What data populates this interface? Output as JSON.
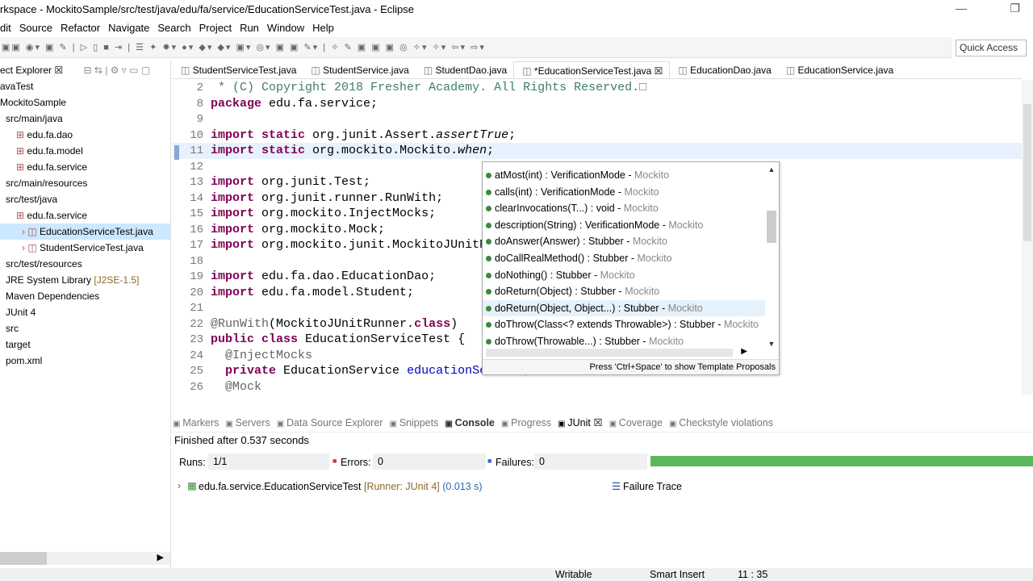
{
  "window": {
    "title": "rkspace - MockitoSample/src/test/java/edu/fa/service/EducationServiceTest.java - Eclipse"
  },
  "menu": [
    "dit",
    "Source",
    "Refactor",
    "Navigate",
    "Search",
    "Project",
    "Run",
    "Window",
    "Help"
  ],
  "quick_access": "Quick Access",
  "explorer": {
    "title": "ect Explorer",
    "items": [
      {
        "label": "avaTest",
        "indent": 0
      },
      {
        "label": "MockitoSample",
        "indent": 0
      },
      {
        "label": "src/main/java",
        "indent": 1
      },
      {
        "label": "edu.fa.dao",
        "indent": 2
      },
      {
        "label": "edu.fa.model",
        "indent": 2
      },
      {
        "label": "edu.fa.service",
        "indent": 2
      },
      {
        "label": "src/main/resources",
        "indent": 1
      },
      {
        "label": "src/test/java",
        "indent": 1
      },
      {
        "label": "edu.fa.service",
        "indent": 2
      },
      {
        "label": "EducationServiceTest.java",
        "indent": 3,
        "selected": true
      },
      {
        "label": "StudentServiceTest.java",
        "indent": 3
      },
      {
        "label": "src/test/resources",
        "indent": 1
      },
      {
        "label": "JRE System Library",
        "suffix": "[J2SE-1.5]",
        "indent": 1
      },
      {
        "label": "Maven Dependencies",
        "indent": 1
      },
      {
        "label": "JUnit 4",
        "indent": 1
      },
      {
        "label": "src",
        "indent": 1
      },
      {
        "label": "target",
        "indent": 1
      },
      {
        "label": "pom.xml",
        "indent": 1
      }
    ]
  },
  "editor_tabs": [
    "StudentServiceTest.java",
    "StudentService.java",
    "StudentDao.java",
    "*EducationServiceTest.java",
    "EducationDao.java",
    "EducationService.java"
  ],
  "active_tab": 3,
  "code": [
    {
      "n": "2",
      "html": "<span class='cm'> * (C) Copyright 2018 Fresher Academy. All Rights Reserved.□</span>"
    },
    {
      "n": "8",
      "html": "<span class='kw'>package</span> edu.fa.service;"
    },
    {
      "n": "9",
      "html": ""
    },
    {
      "n": "10",
      "html": "<span class='kw'>import static</span> org.junit.Assert.<span class='it'>assertTrue</span>;"
    },
    {
      "n": "11",
      "html": "<span class='kw'>import static</span> org.mockito.Mockito.<span class='it'>when</span>;",
      "cur": true
    },
    {
      "n": "12",
      "html": ""
    },
    {
      "n": "13",
      "html": "<span class='kw'>import</span> org.junit.Test;"
    },
    {
      "n": "14",
      "html": "<span class='kw'>import</span> org.junit.runner.RunWith;"
    },
    {
      "n": "15",
      "html": "<span class='kw'>import</span> org.mockito.InjectMocks;"
    },
    {
      "n": "16",
      "html": "<span class='kw'>import</span> org.mockito.Mock;"
    },
    {
      "n": "17",
      "html": "<span class='kw'>import</span> org.mockito.junit.MockitoJUnitRunner;"
    },
    {
      "n": "18",
      "html": ""
    },
    {
      "n": "19",
      "html": "<span class='kw'>import</span> edu.fa.dao.EducationDao;"
    },
    {
      "n": "20",
      "html": "<span class='kw'>import</span> edu.fa.model.Student;"
    },
    {
      "n": "21",
      "html": ""
    },
    {
      "n": "22",
      "html": "<span class='an'>@RunWith</span>(MockitoJUnitRunner.<span class='kw'>class</span>)"
    },
    {
      "n": "23",
      "html": "<span class='kw'>public class</span> EducationServiceTest {"
    },
    {
      "n": "24",
      "html": "  <span class='an'>@InjectMocks</span>"
    },
    {
      "n": "25",
      "html": "  <span class='kw'>private</span> EducationService <span class='fld'>educationService</span>;"
    },
    {
      "n": "26",
      "html": "  <span class='an'>@Mock</span>"
    }
  ],
  "completion": {
    "items": [
      {
        "sig": "atMost(int) : VerificationMode",
        "src": "Mockito"
      },
      {
        "sig": "calls(int) : VerificationMode",
        "src": "Mockito"
      },
      {
        "sig": "clearInvocations(T...) : void",
        "src": "Mockito"
      },
      {
        "sig": "description(String) : VerificationMode",
        "src": "Mockito"
      },
      {
        "sig": "doAnswer(Answer) : Stubber",
        "src": "Mockito"
      },
      {
        "sig": "doCallRealMethod() : Stubber",
        "src": "Mockito"
      },
      {
        "sig": "doNothing() : Stubber",
        "src": "Mockito"
      },
      {
        "sig": "doReturn(Object) : Stubber",
        "src": "Mockito"
      },
      {
        "sig": "doReturn(Object, Object...) : Stubber",
        "src": "Mockito",
        "hover": true
      },
      {
        "sig": "doThrow(Class<? extends Throwable>) : Stubber",
        "src": "Mockito"
      },
      {
        "sig": "doThrow(Throwable...) : Stubber",
        "src": "Mockito"
      }
    ],
    "footer": "Press 'Ctrl+Space' to show Template Proposals"
  },
  "bottom_tabs": [
    "Markers",
    "Servers",
    "Data Source Explorer",
    "Snippets",
    "Console",
    "Progress",
    "JUnit",
    "Coverage",
    "Checkstyle violations"
  ],
  "junit": {
    "finished": "Finished after 0.537 seconds",
    "runs_label": "Runs:",
    "runs": "1/1",
    "errors_label": "Errors:",
    "errors": "0",
    "failures_label": "Failures:",
    "failures": "0",
    "progress": 1.0,
    "bar_color": "#5cb85c",
    "test": "edu.fa.service.EducationServiceTest",
    "runner": "[Runner: JUnit 4]",
    "time": "(0.013 s)",
    "failure_trace": "Failure Trace"
  },
  "status": {
    "writable": "Writable",
    "insert": "Smart Insert",
    "pos": "11 : 35"
  }
}
